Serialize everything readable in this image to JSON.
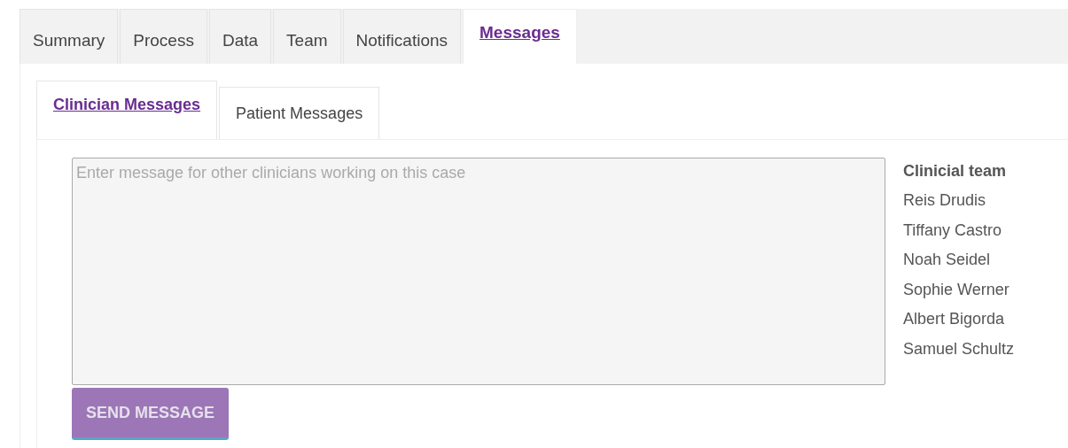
{
  "tabs": [
    {
      "label": "Summary",
      "selected": false
    },
    {
      "label": "Process",
      "selected": false
    },
    {
      "label": "Data",
      "selected": false
    },
    {
      "label": "Team",
      "selected": false
    },
    {
      "label": "Notifications",
      "selected": false
    },
    {
      "label": "Messages",
      "selected": true
    }
  ],
  "subtabs": [
    {
      "label": "Clinician Messages",
      "selected": true
    },
    {
      "label": "Patient Messages",
      "selected": false
    }
  ],
  "message": {
    "placeholder": "Enter message for other clinicians working on this case"
  },
  "send_button": "SEND MESSAGE",
  "team": {
    "title": "Clinicial team",
    "members": [
      "Reis Drudis",
      "Tiffany Castro",
      "Noah Seidel",
      "Sophie Werner",
      "Albert Bigorda",
      "Samuel Schultz"
    ]
  }
}
